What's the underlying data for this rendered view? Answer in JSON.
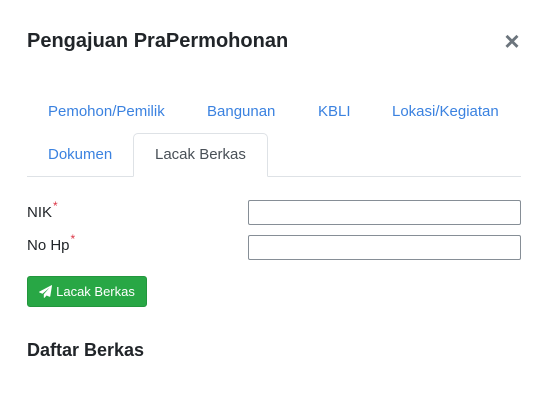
{
  "modal": {
    "title": "Pengajuan PraPermohonan",
    "close_symbol": "×"
  },
  "tabs": [
    {
      "label": "Pemohon/Pemilik",
      "active": false
    },
    {
      "label": "Bangunan",
      "active": false
    },
    {
      "label": "KBLI",
      "active": false
    },
    {
      "label": "Lokasi/Kegiatan",
      "active": false
    },
    {
      "label": "Dokumen",
      "active": false
    },
    {
      "label": "Lacak Berkas",
      "active": true
    }
  ],
  "form": {
    "nik_label": "NIK",
    "nik_value": "",
    "phone_label": "No Hp",
    "phone_value": "",
    "required_marker": "*"
  },
  "actions": {
    "track_button_label": "Lacak Berkas",
    "track_button_icon": "paper-plane-icon"
  },
  "section": {
    "title": "Daftar Berkas"
  },
  "colors": {
    "link": "#3b82e0",
    "success": "#28a745",
    "required": "#dc3545"
  }
}
